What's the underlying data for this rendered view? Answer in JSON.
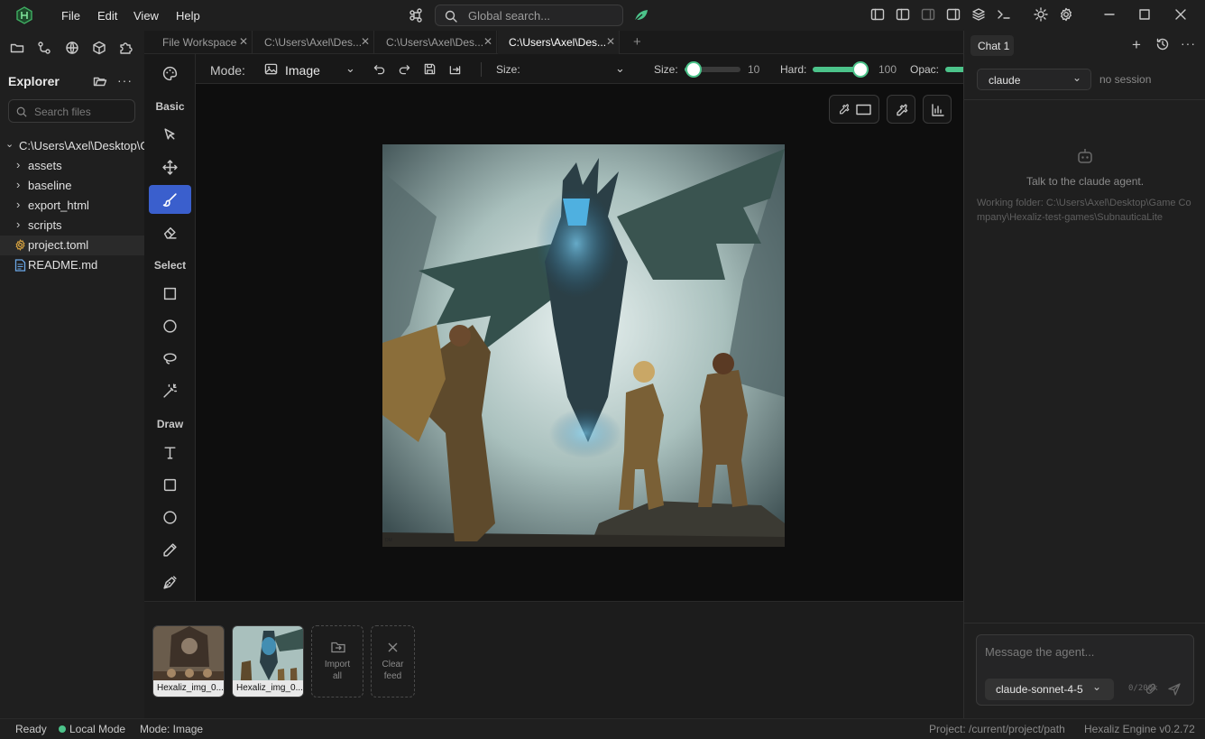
{
  "menu": {
    "file": "File",
    "edit": "Edit",
    "view": "View",
    "help": "Help"
  },
  "search": {
    "placeholder": "Global search..."
  },
  "explorer": {
    "title": "Explorer",
    "search_placeholder": "Search files",
    "root": "C:\\Users\\Axel\\Desktop\\G",
    "items": [
      {
        "label": "assets",
        "type": "folder"
      },
      {
        "label": "baseline",
        "type": "folder"
      },
      {
        "label": "export_html",
        "type": "folder"
      },
      {
        "label": "scripts",
        "type": "folder"
      },
      {
        "label": "project.toml",
        "type": "config"
      },
      {
        "label": "README.md",
        "type": "file"
      }
    ]
  },
  "tabs": [
    {
      "label": "File Workspace"
    },
    {
      "label": "C:\\Users\\Axel\\Des..."
    },
    {
      "label": "C:\\Users\\Axel\\Des..."
    },
    {
      "label": "C:\\Users\\Axel\\Des..."
    }
  ],
  "tools": {
    "basic": "Basic",
    "select": "Select",
    "draw": "Draw"
  },
  "options": {
    "mode_label": "Mode:",
    "mode_value": "Image",
    "size_select_label": "Size:",
    "size_label": "Size:",
    "size_value": "10",
    "hard_label": "Hard:",
    "hard_value": "100",
    "opac_label": "Opac:"
  },
  "feed": {
    "thumbs": [
      {
        "caption": "Hexaliz_img_0..."
      },
      {
        "caption": "Hexaliz_img_0..."
      }
    ],
    "import_label_1": "Import",
    "import_label_2": "all",
    "clear_label_1": "Clear",
    "clear_label_2": "feed"
  },
  "chat": {
    "tab": "Chat 1",
    "agent": "claude",
    "session": "no session",
    "talk": "Talk to the claude agent.",
    "folder": "Working folder: C:\\Users\\Axel\\Desktop\\Game Company\\Hexaliz-test-games\\SubnauticaLite",
    "input_placeholder": "Message the agent...",
    "model": "claude-sonnet-4-5",
    "tokens": "0/200k"
  },
  "status": {
    "ready": "Ready",
    "local": "Local Mode",
    "mode": "Mode: Image",
    "project": "Project: /current/project/path",
    "engine": "Hexaliz Engine v0.2.72"
  },
  "colors": {
    "accent": "#3a5fcd",
    "slider": "#4cc38a",
    "local_dot": "#4cc38a"
  }
}
